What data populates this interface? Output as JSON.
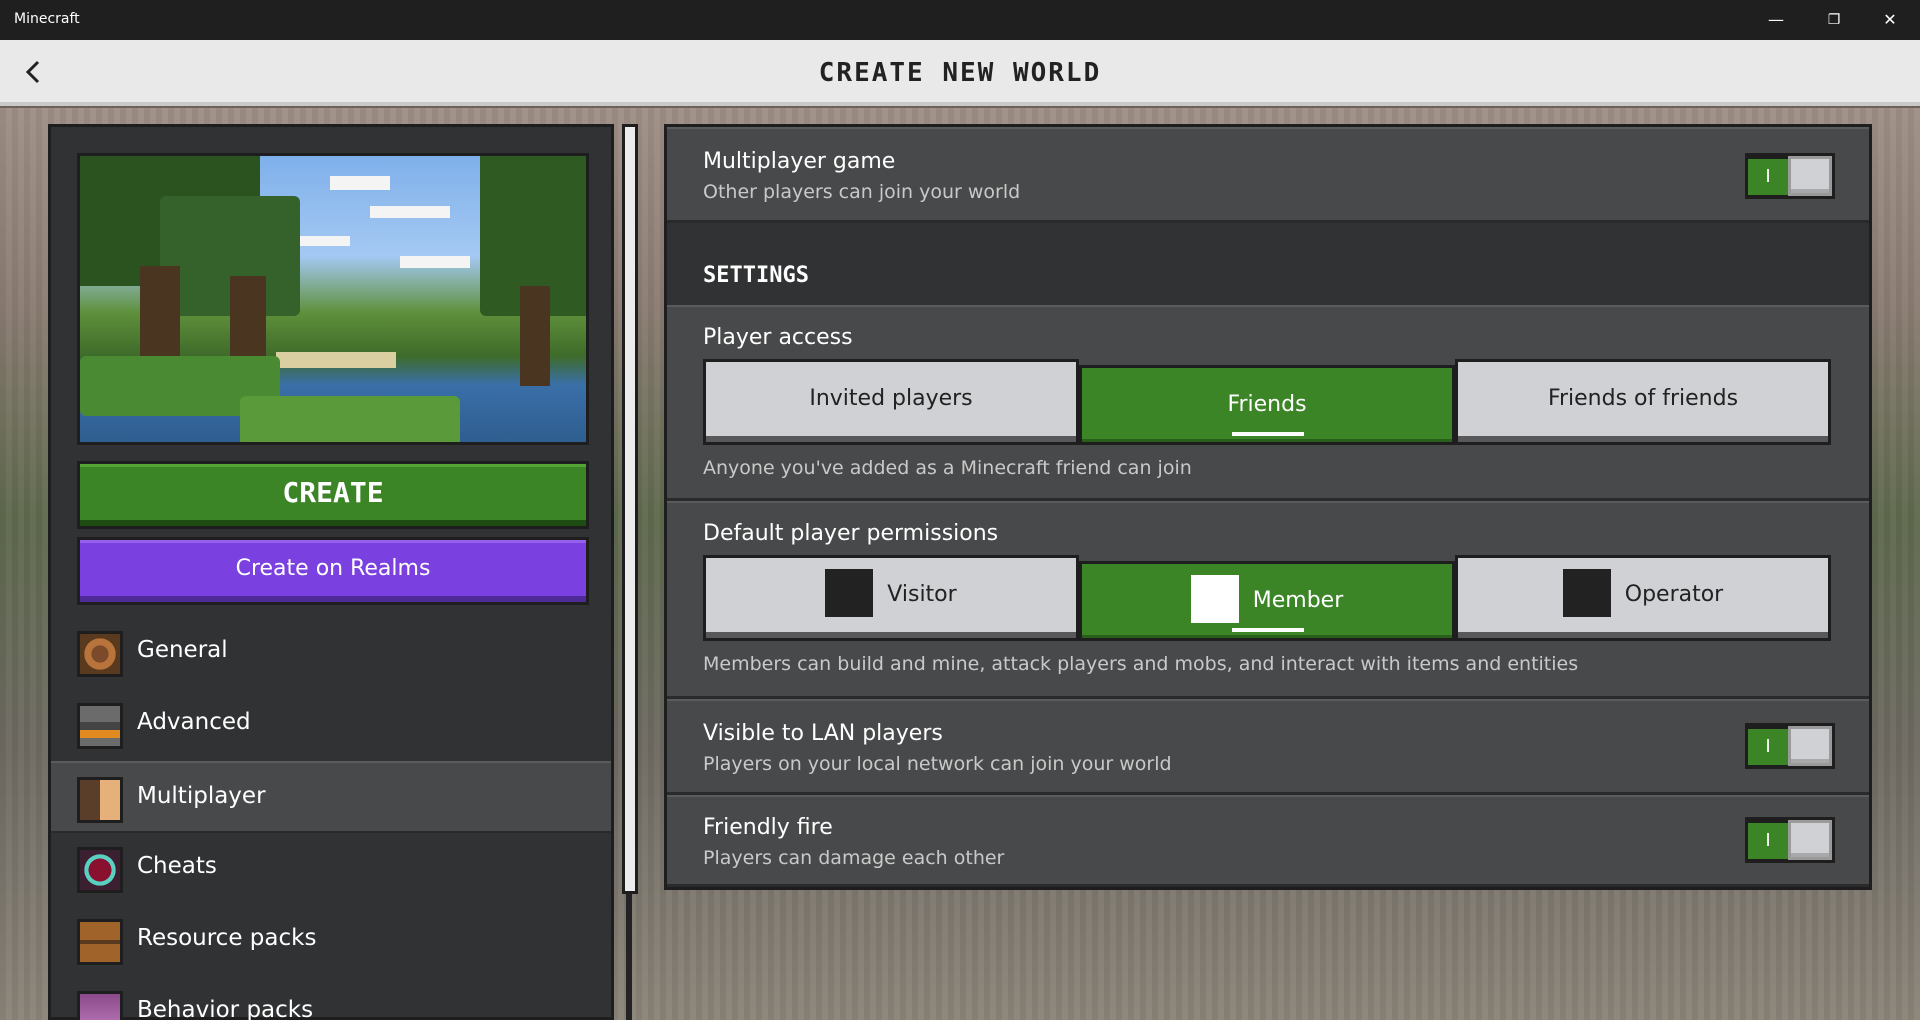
{
  "window": {
    "title": "Minecraft",
    "minimize": "—",
    "restore": "❐",
    "close": "✕"
  },
  "header": {
    "title": "CREATE NEW WORLD",
    "back_icon": "chevron-left-icon"
  },
  "left": {
    "create_label": "CREATE",
    "realms_label": "Create on Realms",
    "nav": [
      {
        "label": "General",
        "icon": "general-icon"
      },
      {
        "label": "Advanced",
        "icon": "advanced-icon"
      },
      {
        "label": "Multiplayer",
        "icon": "multiplayer-icon",
        "active": true
      },
      {
        "label": "Cheats",
        "icon": "cheats-icon"
      },
      {
        "label": "Resource packs",
        "icon": "resource-packs-icon"
      },
      {
        "label": "Behavior packs",
        "icon": "behavior-packs-icon"
      }
    ]
  },
  "right": {
    "multiplayer": {
      "title": "Multiplayer game",
      "desc": "Other players can join your world",
      "toggle": "I"
    },
    "settings_heading": "SETTINGS",
    "player_access": {
      "title": "Player access",
      "options": [
        "Invited players",
        "Friends",
        "Friends of friends"
      ],
      "selected": "Friends",
      "desc": "Anyone you've added as a Minecraft friend can join"
    },
    "permissions": {
      "title": "Default player permissions",
      "options": [
        "Visitor",
        "Member",
        "Operator"
      ],
      "selected": "Member",
      "desc": "Members can build and mine, attack players and mobs, and interact with items and entities"
    },
    "lan": {
      "title": "Visible to LAN players",
      "desc": "Players on your local network can join your world",
      "toggle": "I"
    },
    "friendly_fire": {
      "title": "Friendly fire",
      "desc": "Players can damage each other",
      "toggle": "I"
    }
  },
  "colors": {
    "accent_green": "#3c8527",
    "realms_purple": "#7b40e0",
    "panel": "#313233",
    "row": "#48494a"
  }
}
